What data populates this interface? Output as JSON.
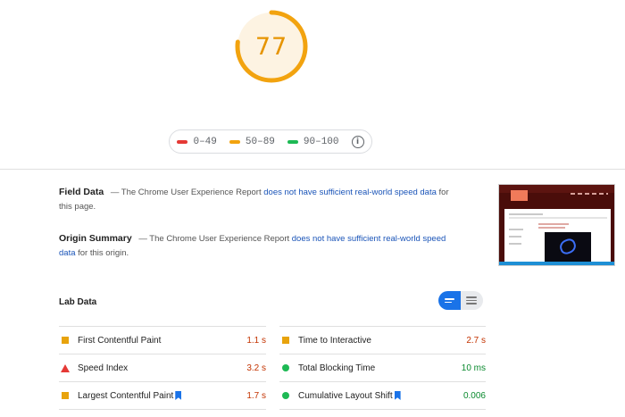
{
  "score": {
    "value": "77",
    "fraction": 0.77,
    "color": "#e69400",
    "track_color": "#fdf3e2"
  },
  "legend": {
    "items": [
      {
        "label": "0–49",
        "color": "#e53935"
      },
      {
        "label": "50–89",
        "color": "#f2a30f"
      },
      {
        "label": "90–100",
        "color": "#1db954"
      }
    ],
    "info_icon": "info-icon"
  },
  "field_data": {
    "heading": "Field Data",
    "text_before": " — The Chrome User Experience Report ",
    "link": "does not have sufficient real-world speed data",
    "text_after": " for this page."
  },
  "origin_summary": {
    "heading": "Origin Summary",
    "text_before": " — The Chrome User Experience Report ",
    "link": "does not have sufficient real-world speed data",
    "text_after": " for this origin."
  },
  "lab_data": {
    "title": "Lab Data",
    "metrics_left": [
      {
        "name": "First Contentful Paint",
        "value": "1.1 s",
        "status": "average",
        "icon": "square-icon",
        "value_color": "#c33300",
        "bookmark": false
      },
      {
        "name": "Speed Index",
        "value": "3.2 s",
        "status": "fail",
        "icon": "triangle-icon",
        "value_color": "#c33300",
        "bookmark": false
      },
      {
        "name": "Largest Contentful Paint",
        "value": "1.7 s",
        "status": "average",
        "icon": "square-icon",
        "value_color": "#c33300",
        "bookmark": true
      }
    ],
    "metrics_right": [
      {
        "name": "Time to Interactive",
        "value": "2.7 s",
        "status": "average",
        "icon": "square-icon",
        "value_color": "#c33300",
        "bookmark": false
      },
      {
        "name": "Total Blocking Time",
        "value": "10 ms",
        "status": "pass",
        "icon": "circle-icon",
        "value_color": "#0a8a2e",
        "bookmark": false
      },
      {
        "name": "Cumulative Layout Shift",
        "value": "0.006",
        "status": "pass",
        "icon": "circle-icon",
        "value_color": "#0a8a2e",
        "bookmark": true
      }
    ]
  },
  "colors": {
    "average": "#e8a30c",
    "fail": "#e53935",
    "pass": "#1db954",
    "link": "#1a54b8",
    "toggle_active": "#1a73e8"
  }
}
